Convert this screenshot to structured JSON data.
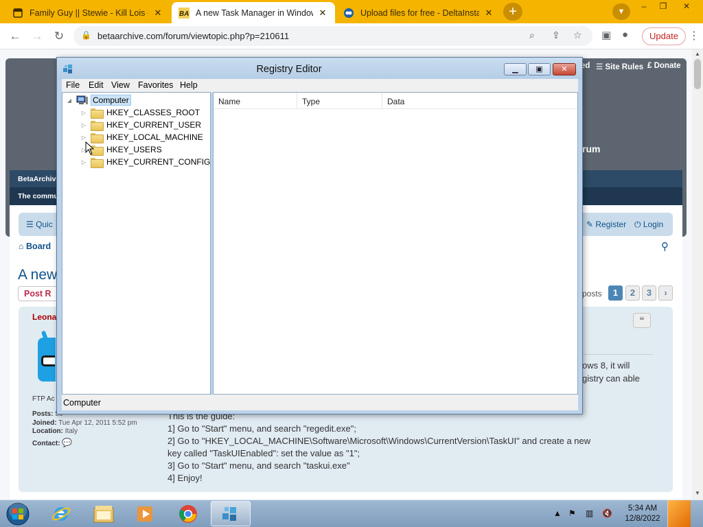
{
  "browser": {
    "tabs": [
      {
        "title": "Family Guy || Stewie - Kill Lois - C",
        "active": false
      },
      {
        "title": "A new Task Manager in Windows",
        "active": true
      },
      {
        "title": "Upload files for free - DeltaInstal",
        "active": false
      }
    ],
    "new_tab": "+",
    "window_controls": [
      "–",
      "❐",
      "✕"
    ],
    "url": "betaarchive.com/forum/viewtopic.php?p=210611",
    "update_label": "Update"
  },
  "page": {
    "header_links": [
      "ed",
      "Site Rules",
      "Donate"
    ],
    "forum_word": "rum",
    "nav_title": "BetaArchive",
    "nav_subtitle": "The commu",
    "quick_label": "Quic",
    "register": "Register",
    "login": "Login",
    "breadcrumb": "Board",
    "topic_title": "A new",
    "post_reply": "Post R",
    "posts_label": "posts",
    "pages": [
      "1",
      "2",
      "3"
    ],
    "author": "Leona",
    "rank": "FTP Ac",
    "profile": {
      "posts_label": "Posts:",
      "posts_value": "50",
      "joined_label": "Joined:",
      "joined_value": "Tue Apr 12, 2011 5:52 pm",
      "location_label": "Location:",
      "location_value": "Italy",
      "contact_label": "Contact:"
    },
    "post_fragments": [
      "ows 8, it will",
      "gistry can able"
    ],
    "post_lines": [
      "This is the guide:",
      "1] Go to \"Start\" menu, and search \"regedit.exe\";",
      "2] Go to \"HKEY_LOCAL_MACHINE\\Software\\Microsoft\\Windows\\CurrentVersion\\TaskUI\" and create a new",
      "key called \"TaskUIEnabled\": set the value as \"1\";",
      "3] Go to \"Start\" menu, and search \"taskui.exe\"",
      "4] Enjoy!"
    ]
  },
  "regedit": {
    "title": "Registry Editor",
    "menu": [
      "File",
      "Edit",
      "View",
      "Favorites",
      "Help"
    ],
    "tree_root": "Computer",
    "tree_items": [
      "HKEY_CLASSES_ROOT",
      "HKEY_CURRENT_USER",
      "HKEY_LOCAL_MACHINE",
      "HKEY_USERS",
      "HKEY_CURRENT_CONFIG"
    ],
    "columns": [
      "Name",
      "Type",
      "Data"
    ],
    "status": "Computer"
  },
  "taskbar": {
    "time": "5:34 AM",
    "date": "12/8/2022"
  },
  "colors": {
    "chrome_frame": "#f5b400",
    "forum_link": "#105289",
    "registry_frame": "#bcd2ea"
  }
}
